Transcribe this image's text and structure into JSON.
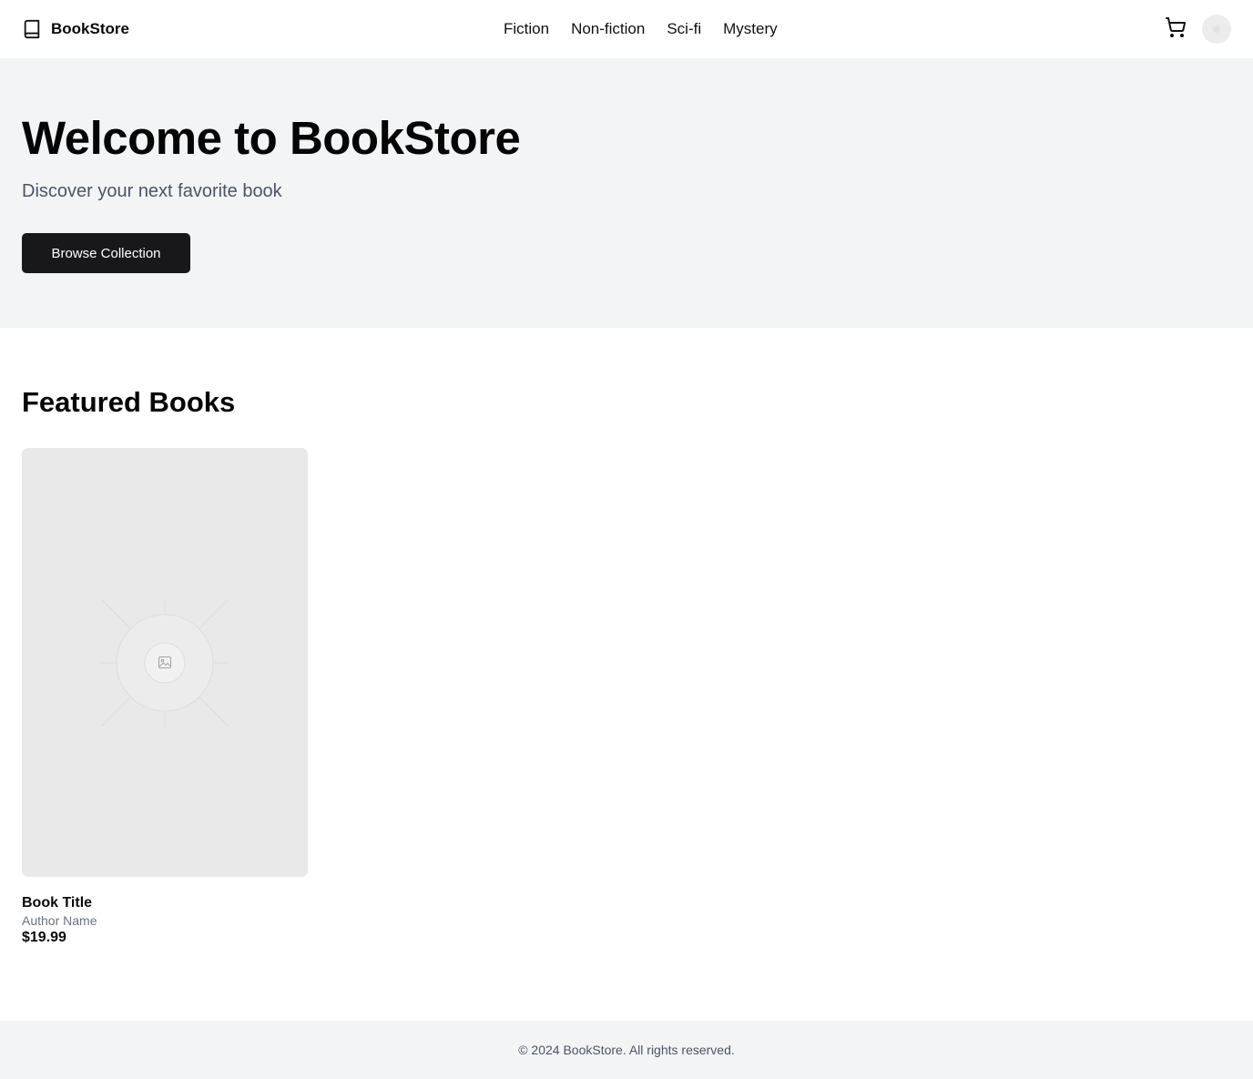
{
  "header": {
    "brand_name": "BookStore",
    "brand_icon": "book-icon",
    "nav": [
      {
        "label": "Fiction"
      },
      {
        "label": "Non-fiction"
      },
      {
        "label": "Sci-fi"
      },
      {
        "label": "Mystery"
      }
    ],
    "cart_icon": "shopping-cart-icon",
    "avatar_icon": "user-avatar"
  },
  "hero": {
    "title": "Welcome to BookStore",
    "subtitle": "Discover your next favorite book",
    "cta_label": "Browse Collection"
  },
  "featured": {
    "heading": "Featured Books",
    "books": [
      {
        "title": "Book Title",
        "author": "Author Name",
        "price": "$19.99",
        "cover_icon": "image-placeholder-icon"
      }
    ]
  },
  "footer": {
    "copyright": "© 2024 BookStore. All rights reserved."
  },
  "colors": {
    "hero_bg": "#f3f4f6",
    "button_bg": "#18181b",
    "cover_bg": "#e9e9e9",
    "muted_text": "#4b5563"
  }
}
